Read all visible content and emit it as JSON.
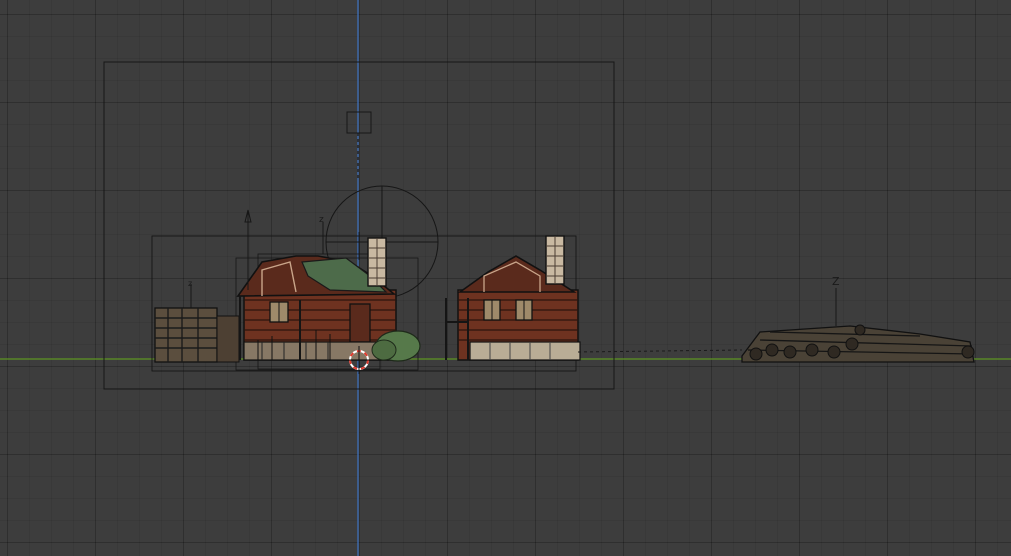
{
  "viewport": {
    "background_color": "#3d3d3d",
    "grid_color": "#333333",
    "x_axis_color": "#5e9622",
    "z_axis_color": "#3e6fb8",
    "wire_color": "#141414"
  },
  "axis_labels": {
    "logpile_empty": "Z",
    "cabin_empty": "z",
    "woodstack_empty": "z"
  },
  "objects": {
    "camera_frame": "camera-frame",
    "sun_lamp": "sun-lamp",
    "left_cabin": "cabin",
    "right_cabin": "cabin",
    "woodstack": "woodstack",
    "log_pile": "log-pile",
    "shrub": "shrub",
    "cursor_3d": "3d-cursor"
  },
  "colors": {
    "wood": "#6e3220",
    "wood_light": "#8a4a2c",
    "wood_dark": "#3f1e14",
    "moss_roof": "#4d6b4a",
    "stone": "#b9ad96",
    "logs": "#4a4236",
    "shrub": "#56794a",
    "cursor_red": "#e03a2e"
  }
}
